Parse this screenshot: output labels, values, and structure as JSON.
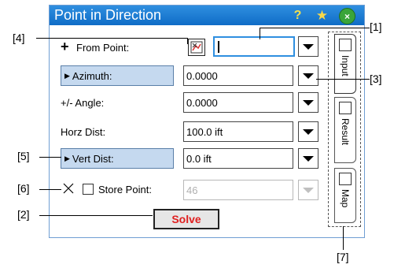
{
  "window": {
    "title": "Point in Direction",
    "help_glyph": "?",
    "fav_glyph": "★",
    "close_glyph": "×"
  },
  "form": {
    "from_point": {
      "label": "From Point:",
      "prefix": "+",
      "value": ""
    },
    "azimuth": {
      "label": "Azimuth:",
      "value": "0.0000"
    },
    "angle": {
      "label": "+/- Angle:",
      "value": "0.0000"
    },
    "horz_dist": {
      "label": "Horz Dist:",
      "value": "100.0 ift"
    },
    "vert_dist": {
      "label": "Vert Dist:",
      "value": "0.0 ift"
    },
    "store_point": {
      "label": "Store Point:",
      "value": "46",
      "checked": false
    },
    "solve_label": "Solve"
  },
  "tabs": [
    {
      "label": "Input",
      "icon": "input-form-icon"
    },
    {
      "label": "Result",
      "icon": "result-document-icon"
    },
    {
      "label": "Map",
      "icon": "map-icon"
    }
  ],
  "callouts": {
    "c1": "[1]",
    "c2": "[2]",
    "c3": "[3]",
    "c4": "[4]",
    "c5": "[5]",
    "c6": "[6]",
    "c7": "[7]"
  }
}
